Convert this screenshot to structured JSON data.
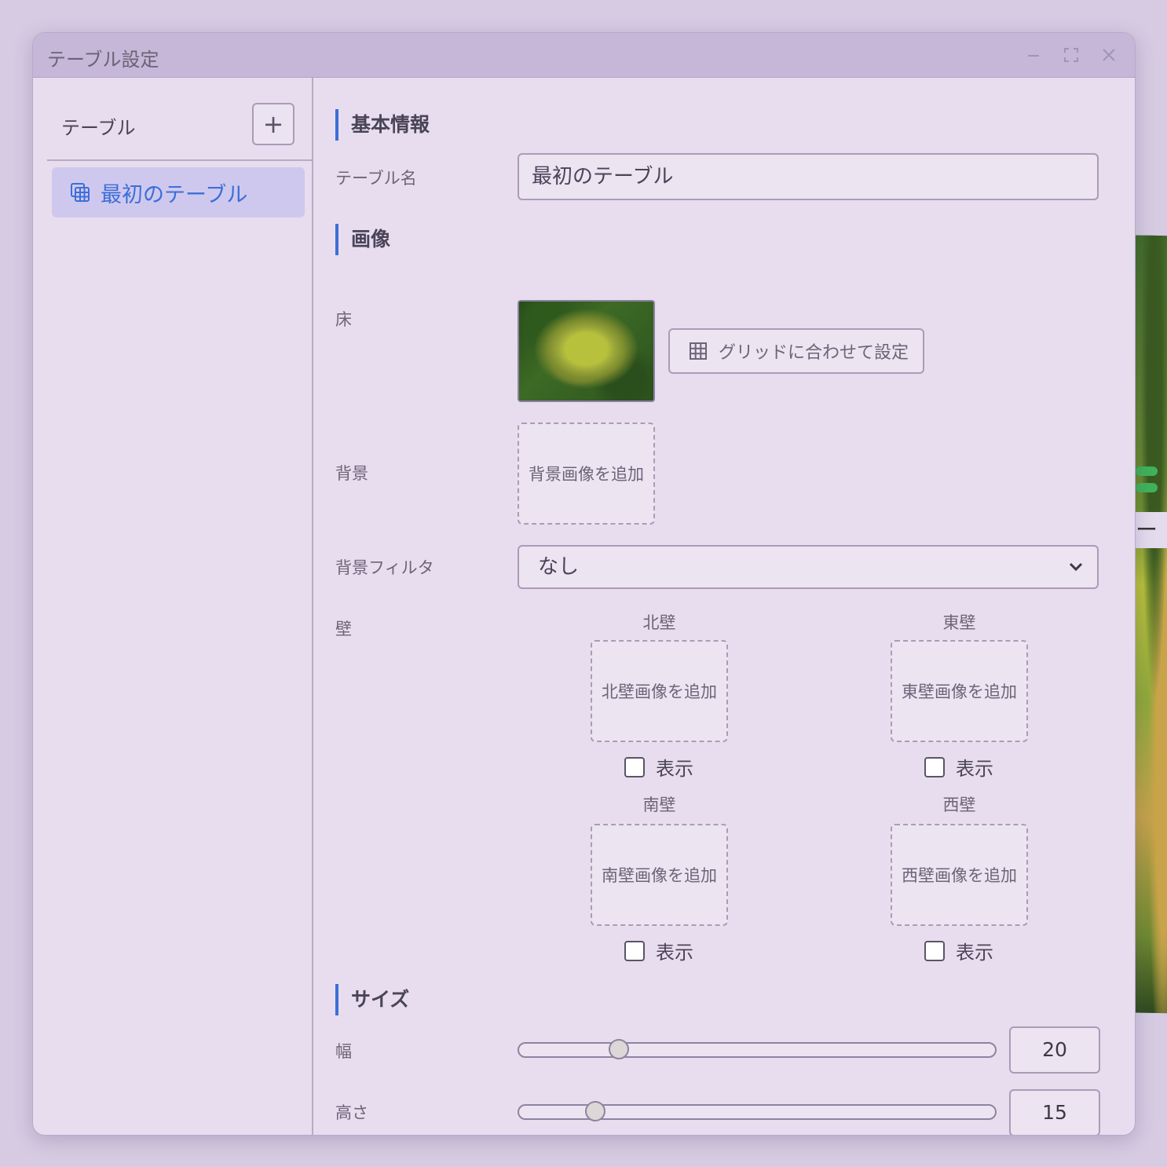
{
  "window": {
    "title": "テーブル設定"
  },
  "sidebar": {
    "title": "テーブル",
    "add_label": "+",
    "items": [
      {
        "label": "最初のテーブル",
        "selected": true
      }
    ]
  },
  "basic": {
    "section_title": "基本情報",
    "name_label": "テーブル名",
    "name_value": "最初のテーブル"
  },
  "image": {
    "section_title": "画像",
    "floor_label": "床",
    "grid_button": "グリッドに合わせて設定",
    "background_label": "背景",
    "background_add": "背景画像を追加",
    "filter_label": "背景フィルタ",
    "filter_value": "なし",
    "wall_label": "壁",
    "walls": [
      {
        "title": "北壁",
        "add": "北壁画像を追加",
        "show": "表示",
        "checked": false
      },
      {
        "title": "東壁",
        "add": "東壁画像を追加",
        "show": "表示",
        "checked": false
      },
      {
        "title": "南壁",
        "add": "南壁画像を追加",
        "show": "表示",
        "checked": false
      },
      {
        "title": "西壁",
        "add": "西壁画像を追加",
        "show": "表示",
        "checked": false
      }
    ]
  },
  "size": {
    "section_title": "サイズ",
    "width_label": "幅",
    "width_value": "20",
    "width_fraction": 0.21,
    "height_label": "高さ",
    "height_value": "15",
    "height_fraction": 0.16
  },
  "colors": {
    "accent": "#3c6fd8",
    "window_bg": "#e8ddee",
    "selected_bg": "#cfc8ee"
  },
  "background_app": {
    "label": "ーB"
  }
}
